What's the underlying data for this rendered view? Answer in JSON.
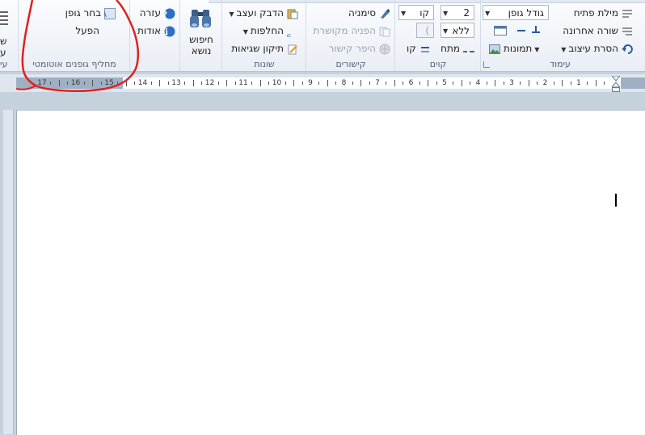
{
  "ribbon": {
    "groups": {
      "header": {
        "label": "עימוד",
        "cover_word": "מילת פתיח",
        "last_line": "שורה אחרונה",
        "remove_format": "הסרת עיצוב",
        "font_size_combo": "גודל גופן",
        "pictures": "תמונות"
      },
      "lines": {
        "label": "קוים",
        "size_value": "2",
        "line_value": "קו",
        "none_value": "ללא",
        "bracket_value": ")",
        "stretch": "מתח",
        "line_label": "קו"
      },
      "links": {
        "label": "קישורים",
        "bookmark": "סימניה",
        "cross_reference": "הפניה מקושרת",
        "hyperlink": "היפר קישור"
      },
      "misc": {
        "label": "שונות",
        "paste_format": "הדבק ועצב",
        "replacements": "החלפות",
        "typo_fix": "תיקון שגיאות"
      },
      "search": {
        "label": "חיפוש\nנושא",
        "line1": "חיפוש",
        "line2": "נושא"
      },
      "help": {
        "help": "עזרה",
        "about": "אודות"
      },
      "font_switch": {
        "label": "מחליף גופנים אוטומטי",
        "choose_font": "בחר גופן",
        "activate": "הפעל"
      },
      "left_cut": {
        "label1": "ש",
        "label2": "ע",
        "group_label": "עי"
      }
    }
  },
  "ruler": {
    "numbers": [
      "17",
      "16",
      "15",
      "14",
      "13",
      "12",
      "11",
      "10",
      "9",
      "8",
      "7",
      "6",
      "5",
      "4",
      "3",
      "2",
      "1"
    ]
  },
  "colors": {
    "annotation": "#e02020",
    "ribbon_bg": "#f3f6fb",
    "page_bg": "#ffffff",
    "frame_bg": "#c6d1de"
  },
  "icons": [
    "help-icon",
    "info-icon",
    "binoculars-icon",
    "paste-format-icon",
    "replace-icon",
    "spell-icon",
    "bookmark-icon",
    "cross-ref-icon",
    "hyperlink-icon",
    "line-stretch-icon",
    "pictures-icon",
    "undo-format-icon",
    "cover-word-icon",
    "font-size-icon",
    "choose-font-icon"
  ]
}
